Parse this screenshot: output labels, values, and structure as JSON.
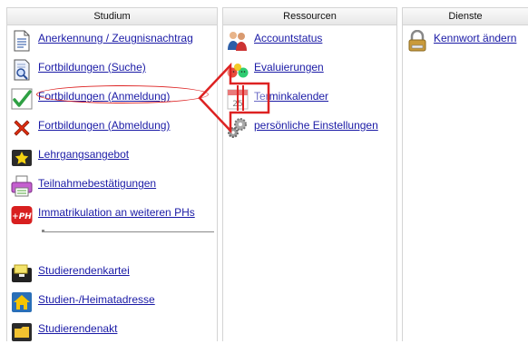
{
  "columns": {
    "studium": {
      "title": "Studium",
      "items": [
        {
          "label": "Anerkennung / Zeugnisnachtrag",
          "icon": "document-icon"
        },
        {
          "label": "Fortbildungen (Suche)",
          "icon": "search-document-icon"
        },
        {
          "label": "Fortbildungen (Anmeldung)",
          "icon": "checkmark-icon"
        },
        {
          "label": "Fortbildungen (Abmeldung)",
          "icon": "red-x-icon"
        },
        {
          "label": "Lehrgangsangebot",
          "icon": "star-folder-icon"
        },
        {
          "label": "Teilnahmebestätigungen",
          "icon": "printer-icon"
        },
        {
          "label": "Immatrikulation an weiteren PHs",
          "icon": "plus-ph-icon",
          "icon_text": "+PH"
        },
        {
          "label": "Studierendenkartei",
          "icon": "card-index-icon"
        },
        {
          "label": "Studien-/Heimatadresse",
          "icon": "home-icon"
        },
        {
          "label": "Studierendenakt",
          "icon": "folder-icon"
        }
      ]
    },
    "ressourcen": {
      "title": "Ressourcen",
      "items": [
        {
          "label": "Accountstatus",
          "icon": "users-icon"
        },
        {
          "label": "Evaluierungen",
          "icon": "smileys-icon"
        },
        {
          "label": "Terminkalender",
          "icon": "calendar-icon",
          "icon_text": "25"
        },
        {
          "label": "persönliche Einstellungen",
          "icon": "gears-icon"
        }
      ]
    },
    "dienste": {
      "title": "Dienste",
      "items": [
        {
          "label": "Kennwort ändern",
          "icon": "padlock-icon"
        }
      ]
    }
  },
  "annotation": {
    "highlight_color": "#dd2222"
  }
}
